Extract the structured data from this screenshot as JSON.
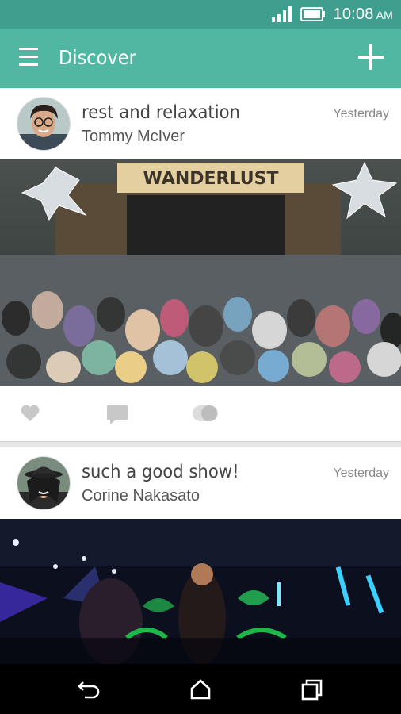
{
  "status": {
    "time": "10:08",
    "ampm": "AM"
  },
  "appbar": {
    "title": "Discover"
  },
  "posts": [
    {
      "title": "rest and relaxation",
      "author": "Tommy McIver",
      "time": "Yesterday",
      "banner": "WANDERLUST"
    },
    {
      "title": "such a good show!",
      "author": "Corine Nakasato",
      "time": "Yesterday"
    }
  ],
  "icons": {
    "menu": "menu-icon",
    "add": "add-icon",
    "like": "heart-icon",
    "comment": "comment-icon",
    "toggle": "toggle-icon",
    "back": "back-icon",
    "home": "home-icon",
    "recents": "recents-icon"
  },
  "colors": {
    "statusbar": "#3f9e8d",
    "appbar": "#4fb7a2",
    "icon_gray": "#c8c8c8"
  }
}
